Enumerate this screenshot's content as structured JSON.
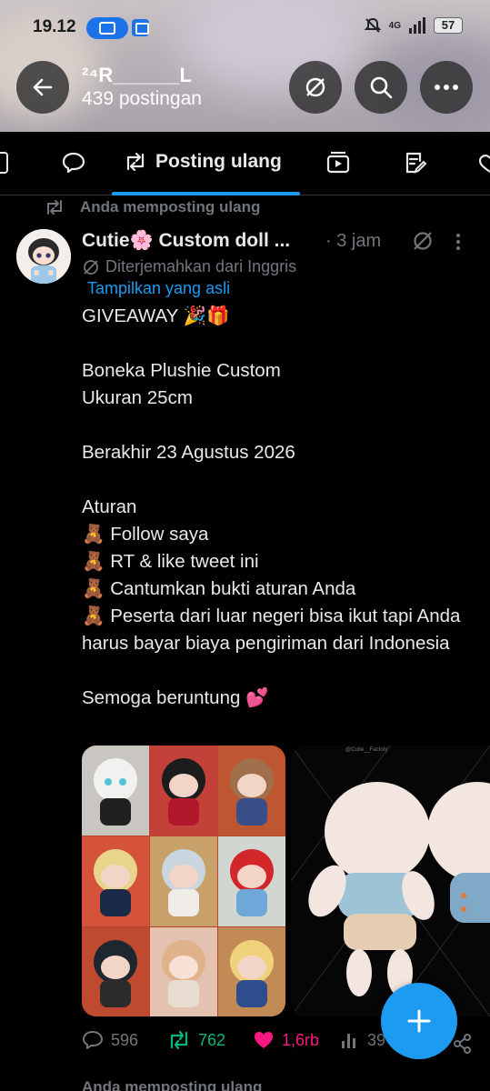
{
  "status_bar": {
    "time": "19.12",
    "network": "4G",
    "battery": "57"
  },
  "header": {
    "name": "²⁴R______L",
    "post_count": "439 postingan"
  },
  "tabs": {
    "active_label": "Posting ulang"
  },
  "repost": {
    "label": "Anda memposting ulang"
  },
  "post": {
    "author": "Cutie🌸 Custom doll ...",
    "time": "· 3 jam",
    "translated_label": "Diterjemahkan dari Inggris",
    "show_original": "Tampilkan yang asli",
    "text": "GIVEAWAY 🎉🎁\n\nBoneka Plushie Custom\nUkuran 25cm\n\nBerakhir 23 Agustus 2026\n\nAturan\n🧸 Follow saya\n🧸 RT & like tweet ini\n🧸 Cantumkan bukti aturan Anda\n🧸 Peserta dari luar negeri bisa ikut tapi Anda harus bayar biaya pengiriman dari Indonesia\n\nSemoga beruntung 💕",
    "media_watermark": "@Cutie__Factory"
  },
  "actions": {
    "replies": "596",
    "reposts": "762",
    "likes": "1,6rb",
    "views": "39"
  },
  "next_item": {
    "label": "Anda memposting ulang"
  },
  "colors": {
    "accent": "#1d9bf0",
    "repost_green": "#00ba7c",
    "like_pink": "#f91880",
    "muted": "#71767b"
  }
}
